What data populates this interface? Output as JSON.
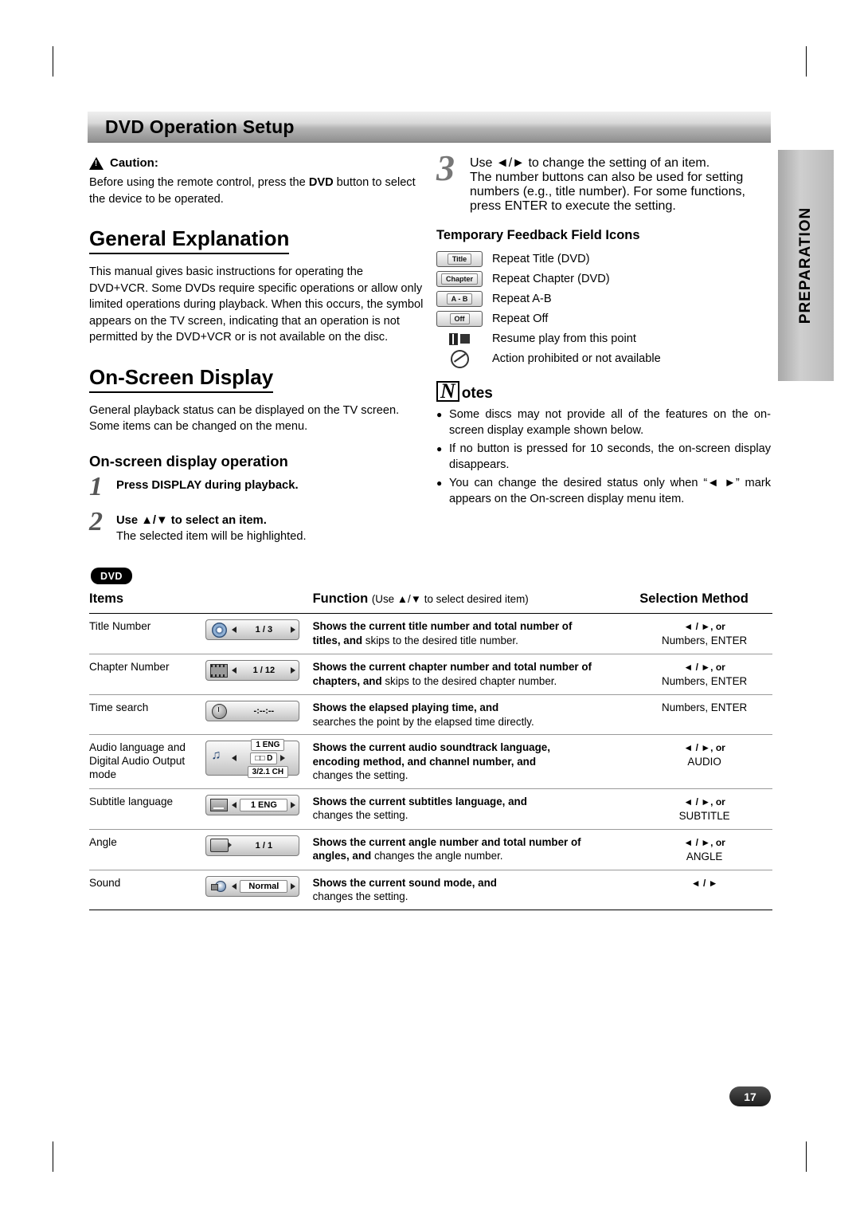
{
  "page": {
    "header_title": "DVD Operation Setup",
    "side_tab": "PREPARATION",
    "page_number": "17"
  },
  "left": {
    "caution_title": "Caution:",
    "caution_body_1": "Before using the remote control, press the ",
    "caution_bold": "DVD",
    "caution_body_2": " button to select the device to be operated.",
    "general_heading": "General Explanation",
    "general_body": "This manual gives basic instructions for operating the DVD+VCR. Some DVDs require specific operations or allow only limited operations during playback. When this occurs, the symbol       appears on the TV screen, indicating that an operation is not permitted by the DVD+VCR or is not available on the disc.",
    "osd_heading": "On-Screen Display",
    "osd_body": "General playback status can be displayed on the TV screen. Some items can be changed on the menu.",
    "osd_sub_heading": "On-screen display operation",
    "step1_num": "1",
    "step1_head": "Press DISPLAY during playback.",
    "step2_num": "2",
    "step2_head": "Use ▲/▼ to select an item.",
    "step2_sub": "The selected item will be highlighted."
  },
  "right": {
    "step3_num": "3",
    "step3_head": "Use ◄/► to change the setting of an item.",
    "step3_body": "The number buttons can also be used for setting numbers (e.g., title number). For some functions, press ENTER to execute the setting.",
    "feedback_heading": "Temporary Feedback Field Icons",
    "feedback_items": [
      {
        "icon_label": "Title",
        "text": "Repeat Title (DVD)"
      },
      {
        "icon_label": "Chapter",
        "text": "Repeat Chapter (DVD)"
      },
      {
        "icon_label": "A - B",
        "text": "Repeat A-B"
      },
      {
        "icon_label": "Off",
        "text": "Repeat Off"
      },
      {
        "icon_label": "",
        "text": "Resume play from this point"
      },
      {
        "icon_label": "",
        "text": "Action prohibited or not available"
      }
    ],
    "notes_glyph": "N",
    "notes_rest": "otes",
    "notes": [
      "Some discs may not provide all of the features on the on-screen display example shown below.",
      "If no button is pressed for 10 seconds, the on-screen display disappears.",
      "You can change the desired status only when “◄ ►” mark appears on the On-screen display menu item."
    ]
  },
  "table_section": {
    "badge": "DVD",
    "columns": {
      "items": "Items",
      "function": "Function",
      "function_note": "(Use ▲/▼ to select desired item)",
      "selection": "Selection Method"
    },
    "rows": [
      {
        "item": "Title Number",
        "icon": {
          "type": "disc",
          "value": "1 / 3"
        },
        "func_bold": "Shows the current title number and total number of",
        "func_bold2": "titles, and ",
        "func_rest": "skips to the desired title number.",
        "sel_arrows": "◄ / ►, or",
        "sel_text": "Numbers, ENTER"
      },
      {
        "item": "Chapter Number",
        "icon": {
          "type": "film",
          "value": "1 / 12"
        },
        "func_bold": "Shows the current chapter number and total number of",
        "func_bold2": "chapters, and ",
        "func_rest": "skips to the desired chapter number.",
        "sel_arrows": "◄ / ►, or",
        "sel_text": "Numbers, ENTER"
      },
      {
        "item": "Time search",
        "icon": {
          "type": "clock",
          "value": "-:--:--"
        },
        "func_bold": "Shows the elapsed playing time, and",
        "func_bold2": "",
        "func_rest": "searches the point by the elapsed time directly.",
        "sel_arrows": "",
        "sel_text": "Numbers, ENTER"
      },
      {
        "item": "Audio language and Digital Audio Output mode",
        "icon": {
          "type": "audio",
          "value1": "1 ENG",
          "value2": "□□ D",
          "value3": "3/2.1 CH"
        },
        "func_bold": "Shows the current audio soundtrack language,",
        "func_bold2": "encoding method, and channel number, and ",
        "func_rest": "changes the setting.",
        "sel_arrows": "◄ / ►, or",
        "sel_text": "AUDIO"
      },
      {
        "item": "Subtitle language",
        "icon": {
          "type": "subtitle",
          "value": "1 ENG"
        },
        "func_bold": "Shows the current subtitles language, and",
        "func_bold2": "",
        "func_rest": "changes the setting.",
        "sel_arrows": "◄ / ►, or",
        "sel_text": "SUBTITLE"
      },
      {
        "item": "Angle",
        "icon": {
          "type": "angle",
          "value": "1 / 1"
        },
        "func_bold": "Shows the current angle number and total number of",
        "func_bold2": "angles, and ",
        "func_rest": "changes the angle number.",
        "sel_arrows": "◄ / ►, or",
        "sel_text": "ANGLE"
      },
      {
        "item": "Sound",
        "icon": {
          "type": "sound",
          "value": "Normal"
        },
        "func_bold": "Shows the current sound mode, and",
        "func_bold2": "",
        "func_rest": "changes the setting.",
        "sel_arrows": "◄ / ►",
        "sel_text": ""
      }
    ]
  }
}
